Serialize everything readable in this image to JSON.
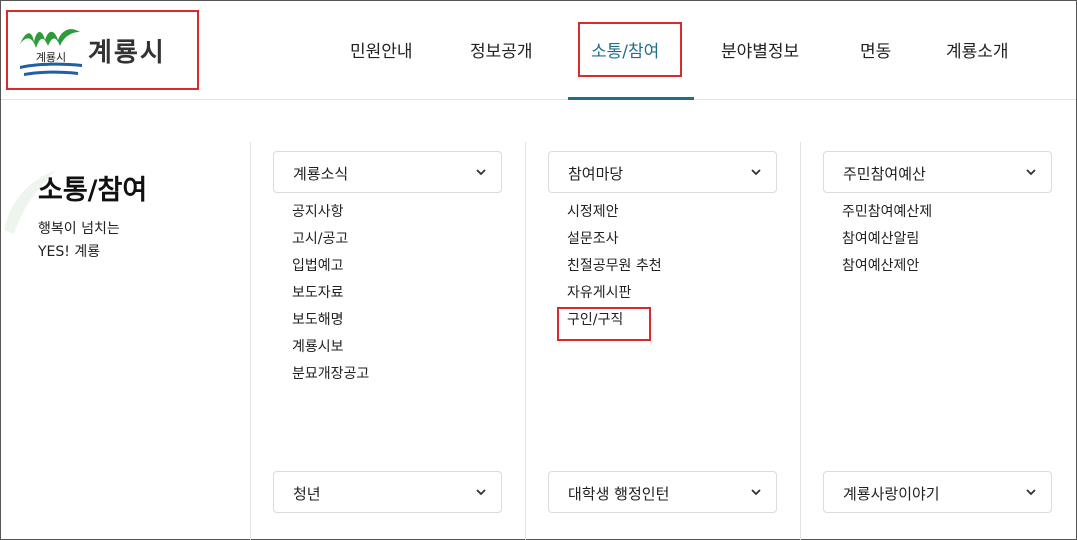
{
  "logo": {
    "emblem_text": "계룡시",
    "name": "계룡시"
  },
  "nav": {
    "items": [
      {
        "label": "민원안내"
      },
      {
        "label": "정보공개"
      },
      {
        "label": "소통/참여"
      },
      {
        "label": "분야별정보"
      },
      {
        "label": "면동"
      },
      {
        "label": "계룡소개"
      }
    ],
    "active_index": 2
  },
  "section": {
    "title": "소통/참여",
    "desc_line1": "행복이 넘치는",
    "desc_line2": "YES! 계룡"
  },
  "columns": [
    {
      "dropdown": "계룡소식",
      "items": [
        "공지사항",
        "고시/공고",
        "입법예고",
        "보도자료",
        "보도해명",
        "계룡시보",
        "분묘개장공고"
      ],
      "bottom_dropdown": "청년"
    },
    {
      "dropdown": "참여마당",
      "items": [
        "시정제안",
        "설문조사",
        "친절공무원 추천",
        "자유게시판",
        "구인/구직"
      ],
      "bottom_dropdown": "대학생 행정인턴"
    },
    {
      "dropdown": "주민참여예산",
      "items": [
        "주민참여예산제",
        "참여예산알림",
        "참여예산제안"
      ],
      "bottom_dropdown": "계룡사랑이야기"
    }
  ],
  "colors": {
    "accent": "#1f6f8b",
    "highlight_box": "#d92b2b",
    "logo_green": "#2e9b3a",
    "logo_blue": "#1d5fa8"
  },
  "icons": {
    "dropdown": "chevron-down-icon"
  }
}
